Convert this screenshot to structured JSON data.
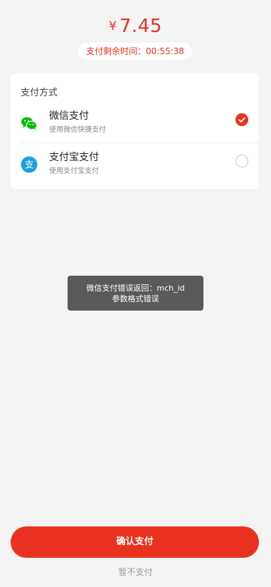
{
  "payment": {
    "currency": "¥",
    "amount": "7.45",
    "countdown": "支付剩余时间：00:55:38"
  },
  "methods_card": {
    "title": "支付方式",
    "methods": [
      {
        "name": "微信支付",
        "desc": "使用微信快捷支付",
        "icon": "wechat-icon",
        "selected": true
      },
      {
        "name": "支付宝支付",
        "desc": "使用支付宝支付",
        "icon": "alipay-icon",
        "selected": false
      }
    ]
  },
  "toast": {
    "line1": "微信支付错误返回：mch_id",
    "line2": "参数格式错误"
  },
  "actions": {
    "confirm_label": "确认支付",
    "skip_label": "暂不支付"
  },
  "colors": {
    "accent": "#e8321f",
    "background": "#f4f4f4",
    "wechat": "#09bb07",
    "alipay": "#1a9fe0",
    "toast_bg": "#5a5a5a"
  }
}
